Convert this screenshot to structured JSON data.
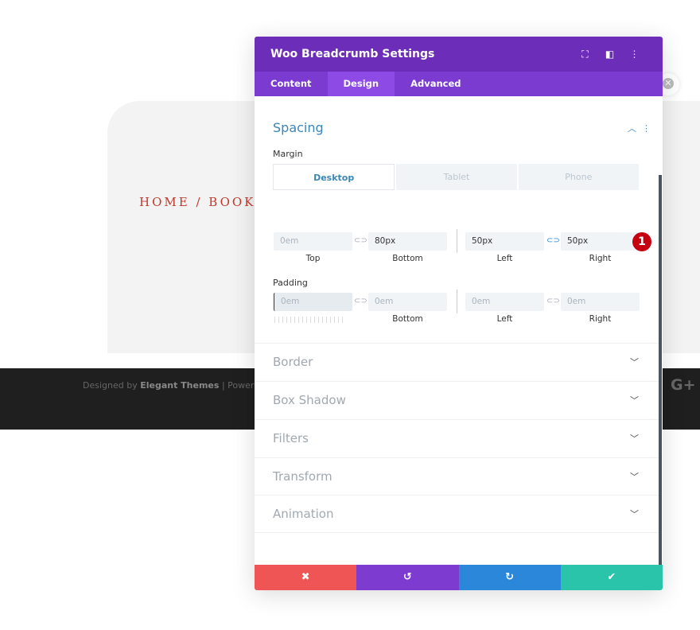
{
  "page": {
    "breadcrumb": "HOME / BOOKS",
    "footer_prefix": "Designed by ",
    "footer_brand": "Elegant Themes",
    "footer_suffix": " | Powered b",
    "social_icon": "google-plus-icon",
    "social_text": "G+"
  },
  "modal": {
    "title": "Woo Breadcrumb Settings",
    "header_icons": [
      "fullscreen-icon",
      "split-view-icon",
      "more-icon"
    ],
    "tabs": [
      {
        "label": "Content"
      },
      {
        "label": "Design"
      },
      {
        "label": "Advanced"
      }
    ],
    "section": "Spacing",
    "margin": {
      "label": "Margin",
      "devices": [
        "Desktop",
        "Tablet",
        "Phone"
      ],
      "top": {
        "value": "",
        "placeholder": "0em",
        "label": "Top"
      },
      "bottom": {
        "value": "80px",
        "label": "Bottom"
      },
      "left": {
        "value": "50px",
        "label": "Left"
      },
      "right": {
        "value": "50px",
        "label": "Right"
      },
      "badge": "1"
    },
    "padding": {
      "label": "Padding",
      "top": {
        "placeholder": "0em"
      },
      "bottom": {
        "placeholder": "0em",
        "label": "Bottom"
      },
      "left": {
        "placeholder": "0em",
        "label": "Left"
      },
      "right": {
        "placeholder": "0em",
        "label": "Right"
      }
    },
    "accordions": [
      "Border",
      "Box Shadow",
      "Filters",
      "Transform",
      "Animation"
    ],
    "footer_colors": {
      "cancel": "#ef5555",
      "undo": "#7e3bd0",
      "redo": "#2b87da",
      "save": "#29c4a9"
    }
  }
}
